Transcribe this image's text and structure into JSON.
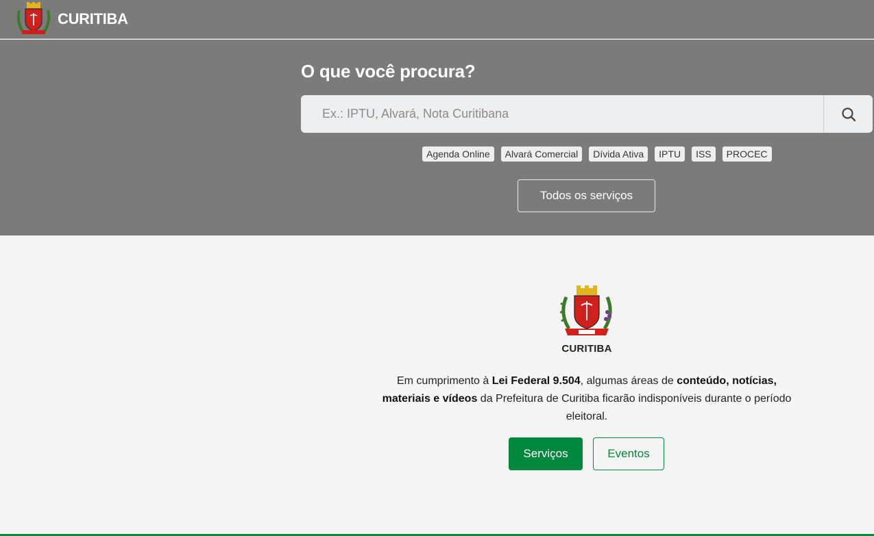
{
  "header": {
    "brand": "CURITIBA",
    "logo_icon": "curitiba-coat-of-arms"
  },
  "hero": {
    "title": "O que você procura?",
    "search": {
      "placeholder": "Ex.: IPTU, Alvará, Nota Curitibana",
      "value": "",
      "icon": "search-icon"
    },
    "quick_tags": [
      "Agenda Online",
      "Alvará Comercial",
      "Dívida Ativa",
      "IPTU",
      "ISS",
      "PROCEC"
    ],
    "all_services_label": "Todos os serviços"
  },
  "main": {
    "logo_word": "CURITIBA",
    "notice": {
      "p1": "Em cumprimento à ",
      "b1": "Lei Federal 9.504",
      "p2": ", algumas áreas de ",
      "b2": "conteúdo, notícias, materiais e vídeos",
      "p3": " da Prefeitura de Curitiba ficarão indisponíveis durante o período eleitoral."
    },
    "btn_servicos": "Serviços",
    "btn_eventos": "Eventos"
  },
  "colors": {
    "header_bg": "#7a7b7a",
    "accent_green": "#00883f",
    "page_bg": "#f4f5f4",
    "shield_red": "#d0201c",
    "crown_gold": "#e3b41b"
  }
}
